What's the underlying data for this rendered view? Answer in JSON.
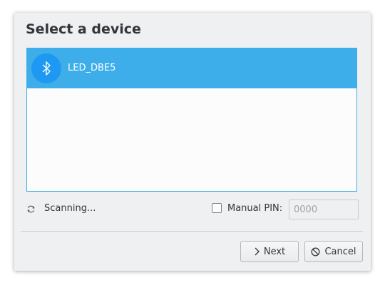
{
  "dialog": {
    "title": "Select a device"
  },
  "devices": [
    {
      "name": "LED_DBE5",
      "icon": "bluetooth-icon",
      "selected": true
    }
  ],
  "status": {
    "scanning_text": "Scanning...",
    "icon": "refresh-icon"
  },
  "pin": {
    "checkbox_label": "Manual PIN:",
    "checked": false,
    "placeholder": "0000"
  },
  "buttons": {
    "next_label": "Next",
    "next_icon": "chevron-right-icon",
    "cancel_label": "Cancel",
    "cancel_icon": "cancel-icon"
  },
  "colors": {
    "accent": "#3daee9",
    "bluetooth_circle": "#1d99f3",
    "dialog_bg": "#eff0f1"
  }
}
